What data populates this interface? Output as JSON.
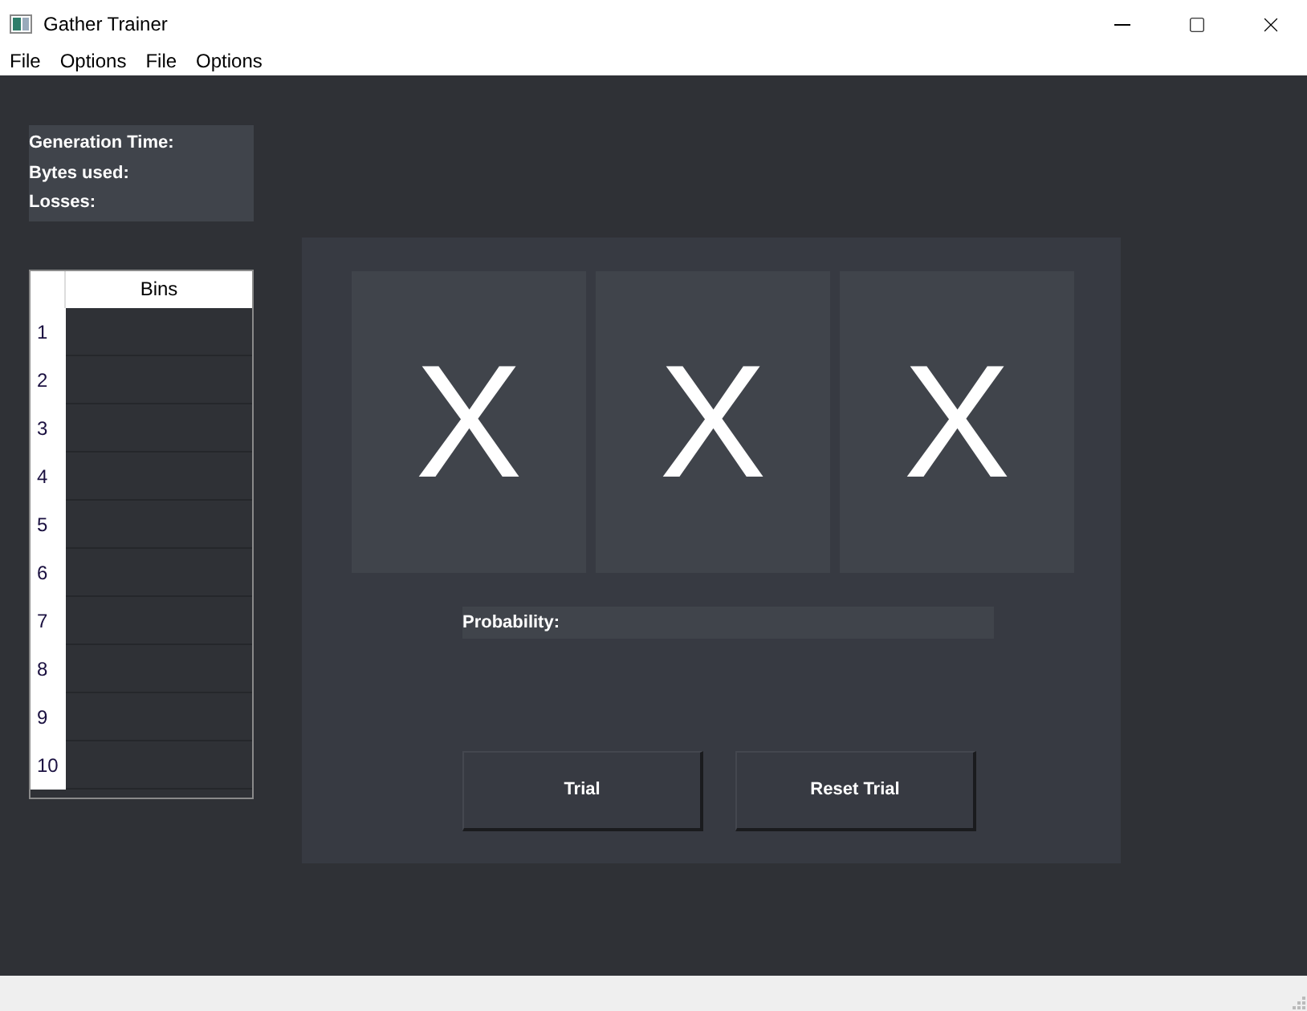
{
  "window": {
    "title": "Gather Trainer"
  },
  "menu": [
    "File",
    "Options",
    "File",
    "Options"
  ],
  "stats": [
    "Generation Time:",
    "Bytes used:",
    "Losses:"
  ],
  "table": {
    "columns": [
      "Bins"
    ],
    "rows": [
      "1",
      "2",
      "3",
      "4",
      "5",
      "6",
      "7",
      "8",
      "9",
      "10"
    ]
  },
  "cards": [
    "X",
    "X",
    "X"
  ],
  "probability": {
    "label": "Probability:"
  },
  "buttons": [
    "Trial",
    "Reset Trial"
  ]
}
